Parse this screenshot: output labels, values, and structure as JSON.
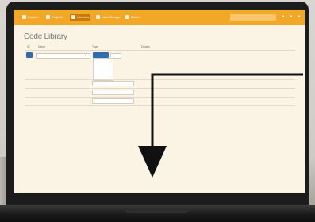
{
  "app": {
    "nav": [
      {
        "label": "Explore"
      },
      {
        "label": "Projects"
      },
      {
        "label": "Libraries"
      },
      {
        "label": "Data Storage"
      },
      {
        "label": "Admin"
      }
    ],
    "active_nav_index": 2,
    "user_label": "",
    "icons": [
      "bell-icon",
      "help-icon",
      "user-icon"
    ]
  },
  "page": {
    "title": "Code Library",
    "columns": [
      "ID",
      "Name",
      "Type",
      "Details"
    ],
    "filter": {
      "id_button": "",
      "name_value": "",
      "type_button": "",
      "type_clear": ""
    },
    "type_options": [
      "",
      "",
      "",
      "",
      "",
      ""
    ],
    "rows": [
      {
        "name": "",
        "type": "",
        "details": ""
      },
      {
        "name": "",
        "type": "",
        "details": ""
      },
      {
        "name": "",
        "type": "",
        "details": ""
      }
    ],
    "pager": ""
  },
  "colors": {
    "topbar": "#f3a726",
    "topbar_active": "#c97a08",
    "page_bg": "#fbf3e3",
    "primary_button": "#2f6db0",
    "arrow": "#111111"
  }
}
